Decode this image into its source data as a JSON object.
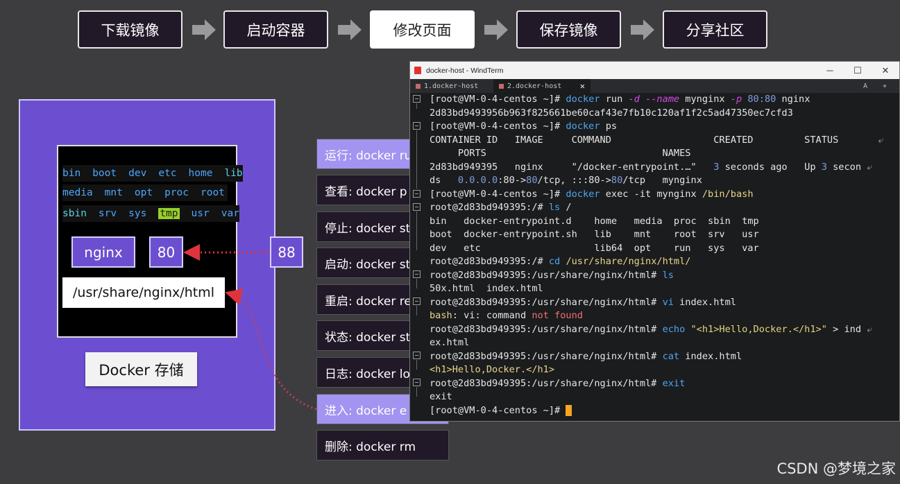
{
  "flow": {
    "steps": [
      "下载镜像",
      "启动容器",
      "修改页面",
      "保存镜像",
      "分享社区"
    ],
    "active_index": 2
  },
  "diagram": {
    "fs_rows": [
      [
        "bin",
        "boot",
        "dev",
        "etc",
        "home",
        "lib"
      ],
      [
        "media",
        "mnt",
        "opt",
        "proc",
        "root"
      ],
      [
        "sbin",
        "srv",
        "sys",
        "tmp",
        "usr",
        "var"
      ]
    ],
    "container_name": "nginx",
    "container_port": "80",
    "host_port": "88",
    "mount_path": "/usr/share/nginx/html",
    "storage_label": "Docker 存储",
    "colors": {
      "panel": "#6c4fd0",
      "dotted_line": "#e0343c"
    }
  },
  "commands": [
    "运行:  docker ru",
    "查看:  docker p",
    "停止:  docker st",
    "启动:  docker st",
    "重启:  docker re",
    "状态:  docker st",
    "日志:  docker lo",
    "进入:  docker e",
    "删除:  docker rm"
  ],
  "terminal": {
    "title": "docker-host - WindTerm",
    "tabs": [
      "1.docker-host",
      "2.docker-host"
    ],
    "tab_tools": "A +",
    "controls": {
      "minimize": "─",
      "maximize": "☐",
      "close": "✕"
    },
    "lines": [
      [
        "[root@VM-0-4-centos ~]# ",
        "docker",
        " run ",
        "-d --name",
        " mynginx ",
        "-p",
        " ",
        "80:80",
        " nginx"
      ],
      [
        "2d83bd9493956b963f825661be60caf43e7fb10c120af1f2c5ad47350ec7cfd3"
      ],
      [
        "[root@VM-0-4-centos ~]# ",
        "docker",
        " ps"
      ],
      [
        "CONTAINER ID   IMAGE     COMMAND                  CREATED         STATUS       ",
        "⤶"
      ],
      [
        "     PORTS                               NAMES"
      ],
      [
        "2d83bd949395   nginx     \"/docker-entrypoint.…\"   ",
        "3",
        " seconds ago   Up ",
        "3",
        " secon ",
        "⤶"
      ],
      [
        "ds   ",
        "0.0.0.0",
        ":80->",
        "80",
        "/tcp, :::80->",
        "80",
        "/tcp   mynginx"
      ],
      [
        "[root@VM-0-4-centos ~]# ",
        "docker",
        " exec -it mynginx ",
        "/bin/bash"
      ],
      [
        "root@2d83bd949395:/# ",
        "ls",
        " /"
      ],
      [
        "bin   docker-entrypoint.d    home   media  proc  sbin  tmp"
      ],
      [
        "boot  docker-entrypoint.sh   lib    mnt    root  srv   usr"
      ],
      [
        "dev   etc                    lib64  opt    run   sys   var"
      ],
      [
        "root@2d83bd949395:/# ",
        "cd",
        " ",
        "/usr/share/nginx/html/"
      ],
      [
        "root@2d83bd949395:/usr/share/nginx/html# ",
        "ls"
      ],
      [
        "50x.html  index.html"
      ],
      [
        "root@2d83bd949395:/usr/share/nginx/html# ",
        "vi",
        " index.html"
      ],
      [
        "bash",
        ": vi: command ",
        "not found"
      ],
      [
        "root@2d83bd949395:/usr/share/nginx/html# ",
        "echo",
        " ",
        "\"<h1>Hello,Docker.</h1>\"",
        " > ind ",
        "⤶"
      ],
      [
        "ex.html"
      ],
      [
        "root@2d83bd949395:/usr/share/nginx/html# ",
        "cat",
        " index.html"
      ],
      [
        "<h1>Hello,Docker.</h1>"
      ],
      [
        "root@2d83bd949395:/usr/share/nginx/html# ",
        "exit"
      ],
      [
        "exit"
      ],
      [
        "[root@VM-0-4-centos ~]# ",
        " "
      ]
    ]
  },
  "watermark": "CSDN @梦境之家"
}
